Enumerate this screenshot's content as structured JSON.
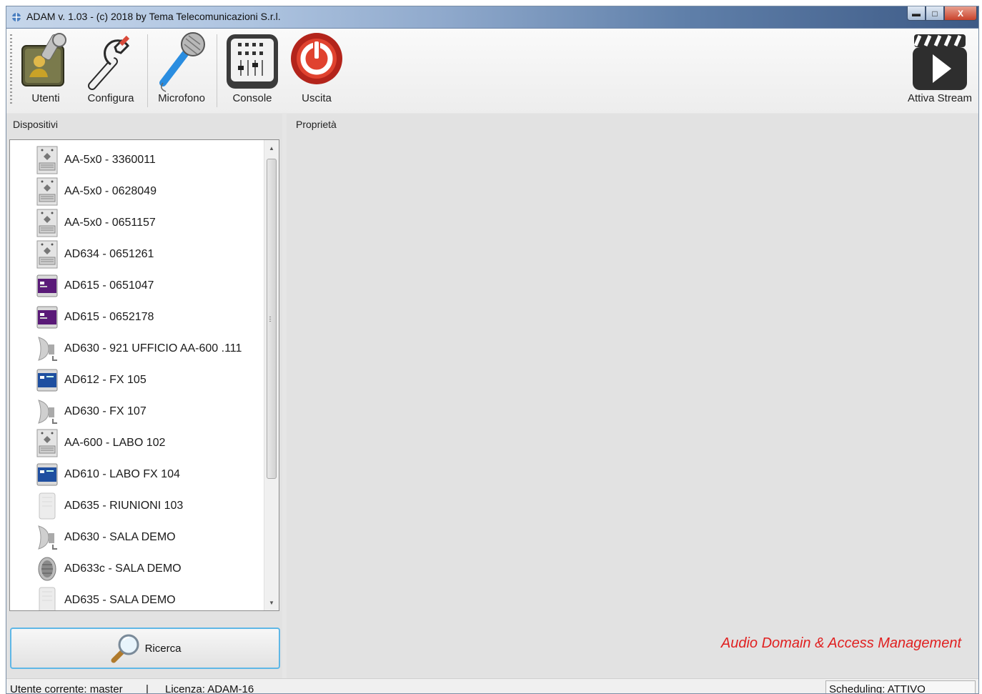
{
  "window": {
    "title": "ADAM v. 1.03 - (c) 2018 by Tema Telecomunicazioni S.r.l.",
    "controls": {
      "minimize": "▬",
      "maximize": "□",
      "close": "X"
    }
  },
  "toolbar": {
    "items": [
      {
        "label": "Utenti",
        "icon": "users-book-key-icon"
      },
      {
        "label": "Configura",
        "icon": "wrench-icon"
      },
      {
        "label": "Microfono",
        "icon": "microphone-icon"
      },
      {
        "label": "Console",
        "icon": "console-mixer-icon"
      },
      {
        "label": "Uscita",
        "icon": "power-exit-icon"
      }
    ],
    "stream": {
      "label": "Attiva Stream",
      "icon": "clapperboard-play-icon"
    }
  },
  "left_panel": {
    "header": "Dispositivi",
    "devices": [
      {
        "label": "AA-5x0 - 3360011",
        "icon": "aa-device-icon"
      },
      {
        "label": "AA-5x0 - 0628049",
        "icon": "aa-device-icon"
      },
      {
        "label": "AA-5x0 - 0651157",
        "icon": "aa-device-icon"
      },
      {
        "label": "AD634 - 0651261",
        "icon": "aa-device-icon"
      },
      {
        "label": "AD615 - 0651047",
        "icon": "purple-module-icon"
      },
      {
        "label": "AD615 - 0652178",
        "icon": "purple-module-icon"
      },
      {
        "label": "AD630 - 921 UFFICIO AA-600 .111",
        "icon": "horn-speaker-icon"
      },
      {
        "label": "AD612 - FX 105",
        "icon": "blue-module-icon"
      },
      {
        "label": "AD630 - FX 107",
        "icon": "horn-speaker-icon"
      },
      {
        "label": "AA-600 - LABO 102",
        "icon": "aa-device-icon"
      },
      {
        "label": "AD610 - LABO FX 104",
        "icon": "blue-module-icon"
      },
      {
        "label": "AD635 - RIUNIONI 103",
        "icon": "wall-panel-icon"
      },
      {
        "label": "AD630 - SALA DEMO",
        "icon": "horn-speaker-icon"
      },
      {
        "label": "AD633c - SALA DEMO",
        "icon": "round-speaker-icon"
      },
      {
        "label": "AD635 - SALA DEMO",
        "icon": "wall-panel-icon"
      }
    ],
    "search_button": "Ricerca"
  },
  "right_panel": {
    "header": "Proprietà",
    "brand_text": "Audio Domain & Access Management",
    "brand_color": "#e02020"
  },
  "statusbar": {
    "user": "Utente corrente: master",
    "separator": "|",
    "license": "Licenza: ADAM-16",
    "scheduling": "Scheduling: ATTIVO"
  }
}
